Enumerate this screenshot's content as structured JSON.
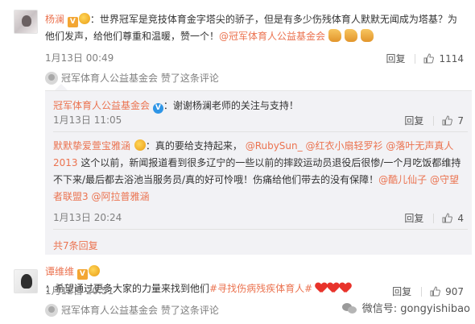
{
  "comment1": {
    "author": "杨澜",
    "badge": "V",
    "text": "：世界冠军是竞技体育金字塔尖的骄子，但是有多少伤残体育人默默无闻成为塔基？为他们发声，给他们尊重和温暖，赞一个！",
    "mention": "@冠军体育人公益基金会",
    "date": "1月13日 00:49",
    "reply_label": "回复",
    "like_count": "1114",
    "liked_by": "冠军体育人公益基金会 赞了这条评论"
  },
  "sub1": {
    "author": "冠军体育人公益基金会",
    "badge": "V",
    "text": "：谢谢杨澜老师的关注与支持！",
    "date": "1月13日 11:05",
    "reply_label": "回复",
    "like_count": "7"
  },
  "sub2": {
    "author": "默默挚爱萱宝雅涵",
    "text_a": "：真的要给支持起来，",
    "mention_a": "@RubySun_",
    "mention_b": "@红衣小扇轻罗衫",
    "mention_c": "@落叶无声真人2013",
    "text_b": "这个以前，新闻报道看到很多辽宁的一些以前的摔跤运动员退役后很惨/一个月吃饭都维持不下来/最后都去浴池当服务员/真的好可怜哦！伤痛给他们带去的没有保障！",
    "mention_d": "@酷儿仙子",
    "mention_e": "@守望者联盟3",
    "mention_f": "@阿拉普雅涵",
    "date": "1月13日 20:24",
    "reply_label": "回复",
    "like_count": "4"
  },
  "expand_label": "共7条回复",
  "comment2": {
    "author": "谭维维",
    "badge": "V",
    "text": "：希望通过更多大家的力量来找到他们",
    "topic": "#寻找伤病残疾体育人#",
    "date": "1月12日 20:51",
    "reply_label": "回复",
    "like_count": "907",
    "liked_by": "冠军体育人公益基金会 赞了这条评论"
  },
  "watermark": "微信号: gongyishibao",
  "colors": {
    "link": "#eb7350",
    "panel_bg": "#f2f2f5",
    "vip_badge": "#f3a633",
    "org_badge": "#2e95e6"
  }
}
